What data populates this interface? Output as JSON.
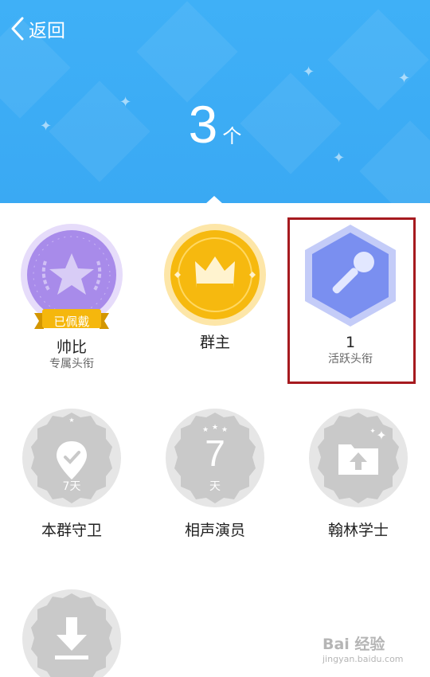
{
  "nav": {
    "back_label": "返回"
  },
  "header": {
    "count": "3",
    "unit": "个"
  },
  "colors": {
    "header_bg": "#3aa9f3",
    "purple": "#a88bea",
    "gold": "#f6b90f",
    "blue": "#7a8ff0",
    "gray": "#c9c9c9",
    "highlight": "#a61a1f"
  },
  "titles": [
    {
      "name": "帅比",
      "subtitle": "专属头衔",
      "ribbon": "已佩戴",
      "icon": "star-laurel-icon"
    },
    {
      "name": "群主",
      "subtitle": "",
      "icon": "crown-icon"
    },
    {
      "name": "1",
      "subtitle": "活跃头衔",
      "icon": "microphone-icon"
    },
    {
      "name": "本群守卫",
      "subtitle": "",
      "days": "7天",
      "icon": "location-check-icon"
    },
    {
      "name": "相声演员",
      "subtitle": "",
      "days_num": "7",
      "days_unit": "天",
      "icon": "seven-days-icon"
    },
    {
      "name": "翰林学士",
      "subtitle": "",
      "icon": "folder-upload-icon"
    },
    {
      "name": "",
      "subtitle": "",
      "icon": "download-icon"
    }
  ],
  "watermark": {
    "brand": "Bai 经验",
    "url": "jingyan.baidu.com"
  }
}
